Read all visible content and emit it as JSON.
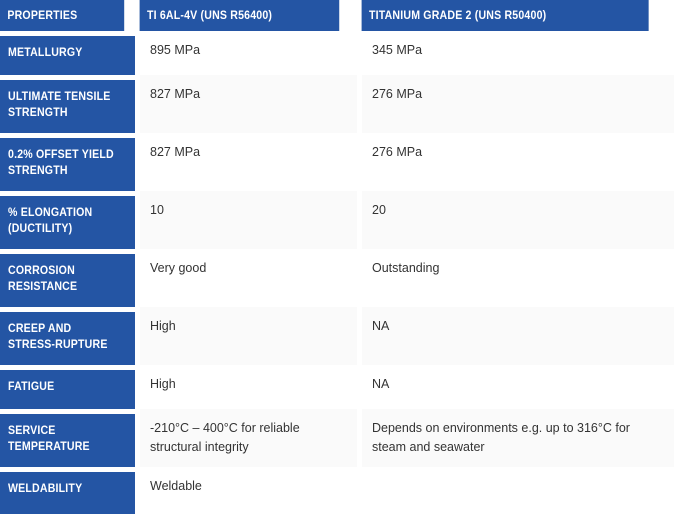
{
  "table": {
    "headers": [
      {
        "label": "PROPERTIES"
      },
      {
        "label": "TI 6AL-4V (UNS R56400)"
      },
      {
        "label": "TITANIUM GRADE 2 (UNS R50400)"
      }
    ],
    "rows": [
      {
        "property": "METALLURGY",
        "ti6al4v": "895 MPa",
        "grade2": "345 MPa"
      },
      {
        "property": "ULTIMATE TENSILE STRENGTH",
        "ti6al4v": "827 MPa",
        "grade2": "276 MPa"
      },
      {
        "property": "0.2% OFFSET YIELD STRENGTH",
        "ti6al4v": "827 MPa",
        "grade2": "276 MPa"
      },
      {
        "property": "% ELONGATION (DUCTILITY)",
        "ti6al4v": "10",
        "grade2": "20"
      },
      {
        "property": "CORROSION RESISTANCE",
        "ti6al4v": "Very good",
        "grade2": "Outstanding"
      },
      {
        "property": "CREEP AND STRESS-RUPTURE",
        "ti6al4v": "High",
        "grade2": "NA"
      },
      {
        "property": "FATIGUE",
        "ti6al4v": "High",
        "grade2": "NA"
      },
      {
        "property": "SERVICE TEMPERATURE",
        "ti6al4v": "-210°C – 400°C for reliable structural integrity",
        "grade2": "Depends on environments e.g. up to 316°C for steam and seawater"
      },
      {
        "property": "WELDABILITY",
        "ti6al4v": "Weldable",
        "grade2": ""
      }
    ]
  },
  "colors": {
    "header_blue": "#2455a4",
    "property_blue": "#2455a4",
    "header_text": "#ffffff",
    "body_text": "#333333",
    "row_white": "#ffffff",
    "row_gray": "#fafafa",
    "gap": "#ffffff"
  }
}
